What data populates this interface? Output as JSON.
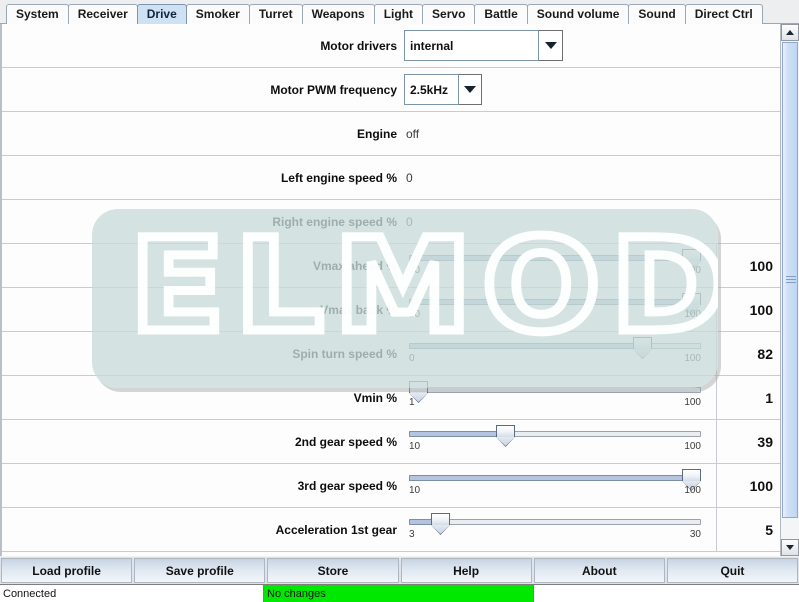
{
  "tabs": [
    {
      "label": "System",
      "selected": false
    },
    {
      "label": "Receiver",
      "selected": false
    },
    {
      "label": "Drive",
      "selected": true
    },
    {
      "label": "Smoker",
      "selected": false
    },
    {
      "label": "Turret",
      "selected": false
    },
    {
      "label": "Weapons",
      "selected": false
    },
    {
      "label": "Light",
      "selected": false
    },
    {
      "label": "Servo",
      "selected": false
    },
    {
      "label": "Battle",
      "selected": false
    },
    {
      "label": "Sound volume",
      "selected": false
    },
    {
      "label": "Sound",
      "selected": false
    },
    {
      "label": "Direct Ctrl",
      "selected": false
    }
  ],
  "rows": [
    {
      "label": "Motor drivers",
      "type": "combo",
      "value": "internal",
      "width": "wide"
    },
    {
      "label": "Motor PWM frequency",
      "type": "combo",
      "value": "2.5kHz",
      "width": "narrow"
    },
    {
      "label": "Engine",
      "type": "text",
      "value": "off"
    },
    {
      "label": "Left engine speed %",
      "type": "text",
      "value": "0"
    },
    {
      "label": "Right engine speed %",
      "type": "text",
      "value": "0"
    },
    {
      "label": "Vmax ahead %",
      "type": "slider",
      "min": "20",
      "max": "100",
      "value": "100",
      "pct": 100
    },
    {
      "label": "Vmax back %",
      "type": "slider",
      "min": "20",
      "max": "100",
      "value": "100",
      "pct": 100
    },
    {
      "label": "Spin turn speed %",
      "type": "slider",
      "min": "0",
      "max": "100",
      "value": "82",
      "pct": 82
    },
    {
      "label": "Vmin %",
      "type": "slider",
      "min": "1",
      "max": "100",
      "value": "1",
      "pct": 0
    },
    {
      "label": "2nd gear speed %",
      "type": "slider",
      "min": "10",
      "max": "100",
      "value": "39",
      "pct": 32
    },
    {
      "label": "3rd gear speed %",
      "type": "slider",
      "min": "10",
      "max": "100",
      "value": "100",
      "pct": 100
    },
    {
      "label": "Acceleration 1st gear",
      "type": "slider",
      "min": "3",
      "max": "30",
      "value": "5",
      "pct": 8
    }
  ],
  "overlay": {
    "watermark_text": "ELMOD"
  },
  "buttons": [
    {
      "label": "Load profile"
    },
    {
      "label": "Save profile"
    },
    {
      "label": "Store"
    },
    {
      "label": "Help"
    },
    {
      "label": "About"
    },
    {
      "label": "Quit"
    }
  ],
  "statusbar": {
    "connection": "Connected",
    "progress_text": "No changes",
    "progress_percent": 100,
    "progress_color": "#00e800"
  },
  "scrollbar": {
    "up_icon": "chevron-up-icon",
    "down_icon": "chevron-down-icon",
    "thumb_position_percent": 0
  }
}
